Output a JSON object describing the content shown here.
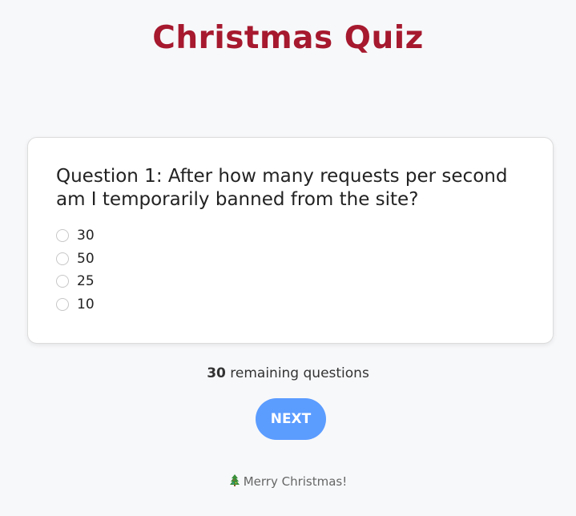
{
  "header": {
    "title": "Christmas Quiz"
  },
  "quiz": {
    "question": "Question 1: After how many requests per second am I temporarily banned from the site?",
    "options": [
      {
        "label": "30"
      },
      {
        "label": "50"
      },
      {
        "label": "25"
      },
      {
        "label": "10"
      }
    ]
  },
  "progress": {
    "remaining_count": "30",
    "remaining_text": " remaining questions"
  },
  "actions": {
    "next_label": "NEXT"
  },
  "footer": {
    "icon": "christmas-tree-icon",
    "text": "Merry Christmas!"
  },
  "colors": {
    "title": "#a6192e",
    "button": "#5b9cff",
    "background": "#f7f8fa"
  }
}
